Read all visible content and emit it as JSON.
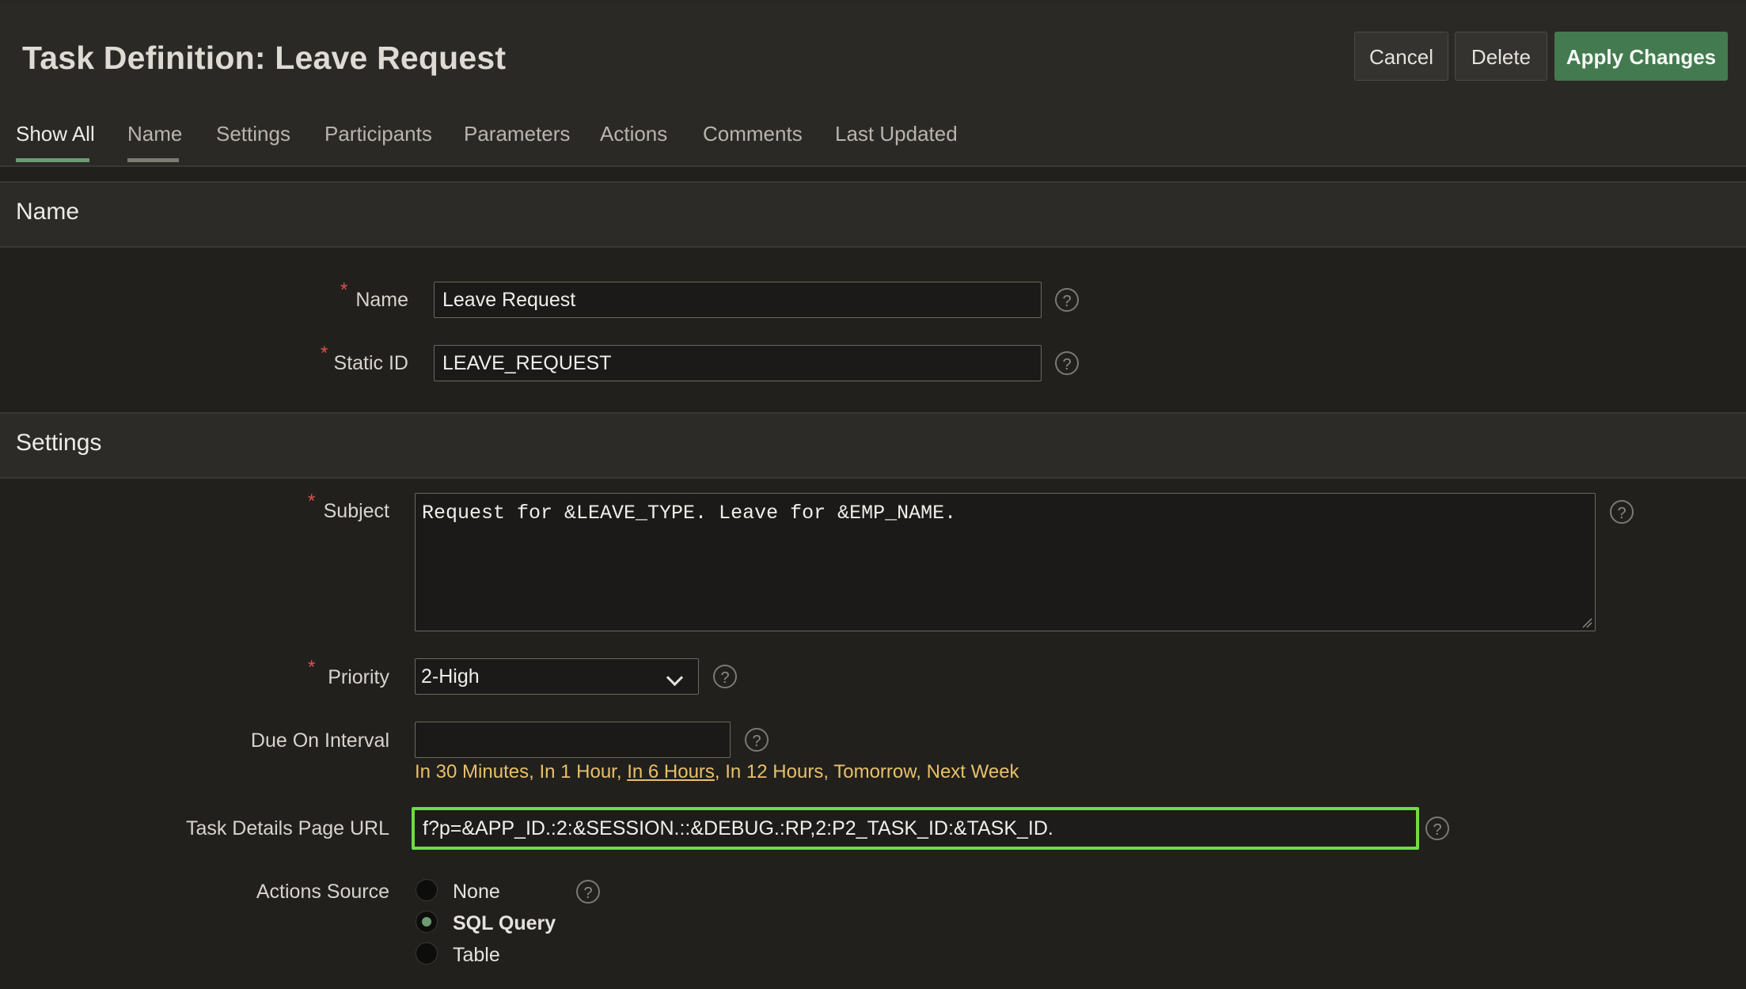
{
  "page": {
    "title": "Task Definition: Leave Request"
  },
  "toolbar": {
    "cancel": "Cancel",
    "delete": "Delete",
    "apply": "Apply Changes"
  },
  "tabs": [
    "Show All",
    "Name",
    "Settings",
    "Participants",
    "Parameters",
    "Actions",
    "Comments",
    "Last Updated"
  ],
  "sections": {
    "name": {
      "title": "Name",
      "name_label": "Name",
      "name_value": "Leave Request",
      "static_id_label": "Static ID",
      "static_id_value": "LEAVE_REQUEST"
    },
    "settings": {
      "title": "Settings",
      "subject_label": "Subject",
      "subject_value": "Request for &LEAVE_TYPE. Leave for &EMP_NAME.",
      "priority_label": "Priority",
      "priority_value": "2-High",
      "due_label": "Due On Interval",
      "due_value": "",
      "due_quick": [
        "In 30 Minutes",
        "In 1 Hour",
        "In 6 Hours",
        "In 12 Hours",
        "Tomorrow",
        "Next Week"
      ],
      "url_label": "Task Details Page URL",
      "url_value": "f?p=&APP_ID.:2:&SESSION.::&DEBUG.:RP,2:P2_TASK_ID:&TASK_ID.",
      "actions_label": "Actions Source",
      "actions_options": [
        "None",
        "SQL Query",
        "Table"
      ],
      "actions_selected": "SQL Query"
    }
  },
  "help_glyph": "?",
  "colors": {
    "accent": "#447a50",
    "focus": "#6fdc46",
    "required": "#d9534f",
    "link": "#e7c06a"
  }
}
